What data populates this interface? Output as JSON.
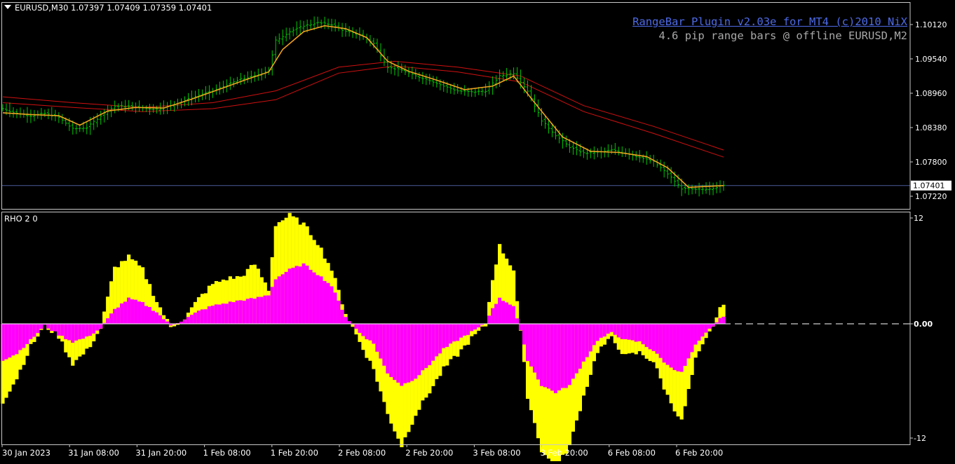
{
  "window": {
    "symbol_line": "EURUSD,M30  1.07397 1.07409 1.07359 1.07401",
    "plugin_title": "RangeBar Plugin v2.03e for MT4 (c)2010 NiX",
    "plugin_subtitle": "4.6 pip range bars @ offline EURUSD,M2",
    "indicator_label": "RHO 2 0"
  },
  "colors": {
    "background": "#000000",
    "bars": "#00c800",
    "ma_fast": "#f0a020",
    "ma_slow": "#d01010",
    "current_price_line": "#4a5a9a",
    "histogram_outer": "#ffff00",
    "histogram_inner": "#ff00ff",
    "axis": "#c8c8c8"
  },
  "chart_data": [
    {
      "type": "candlestick",
      "symbol": "EURUSD",
      "timeframe": "M30",
      "current_price": "1.07401",
      "y_ticks": [
        "1.10120",
        "1.09540",
        "1.08960",
        "1.08380",
        "1.07800",
        "1.07220"
      ],
      "ylim": [
        1.0705,
        1.104
      ],
      "x_ticks": [
        "30 Jan 2023",
        "31 Jan 08:00",
        "31 Jan 20:00",
        "1 Feb 08:00",
        "1 Feb 20:00",
        "2 Feb 08:00",
        "2 Feb 20:00",
        "3 Feb 08:00",
        "3 Feb 20:00",
        "6 Feb 08:00",
        "6 Feb 20:00"
      ],
      "close_path": [
        [
          0,
          1.087
        ],
        [
          4,
          1.0862
        ],
        [
          8,
          1.0858
        ],
        [
          12,
          1.0862
        ],
        [
          16,
          1.0855
        ],
        [
          20,
          1.0836
        ],
        [
          24,
          1.0838
        ],
        [
          28,
          1.0858
        ],
        [
          32,
          1.0874
        ],
        [
          36,
          1.0874
        ],
        [
          40,
          1.0871
        ],
        [
          44,
          1.0869
        ],
        [
          48,
          1.0875
        ],
        [
          52,
          1.0884
        ],
        [
          56,
          1.0893
        ],
        [
          60,
          1.09
        ],
        [
          64,
          1.091
        ],
        [
          68,
          1.092
        ],
        [
          72,
          1.0925
        ],
        [
          76,
          1.0935
        ],
        [
          78,
          1.0985
        ],
        [
          82,
          1.1
        ],
        [
          86,
          1.101
        ],
        [
          90,
          1.1015
        ],
        [
          94,
          1.1012
        ],
        [
          98,
          1.1
        ],
        [
          102,
          1.0995
        ],
        [
          106,
          1.098
        ],
        [
          110,
          1.094
        ],
        [
          114,
          1.0935
        ],
        [
          118,
          1.0925
        ],
        [
          122,
          1.0918
        ],
        [
          126,
          1.0908
        ],
        [
          130,
          1.09
        ],
        [
          134,
          1.0898
        ],
        [
          138,
          1.09
        ],
        [
          142,
          1.0925
        ],
        [
          146,
          1.093
        ],
        [
          150,
          1.09
        ],
        [
          154,
          1.085
        ],
        [
          158,
          1.0825
        ],
        [
          162,
          1.0805
        ],
        [
          166,
          1.0795
        ],
        [
          170,
          1.0796
        ],
        [
          174,
          1.08
        ],
        [
          178,
          1.0795
        ],
        [
          182,
          1.0788
        ],
        [
          186,
          1.078
        ],
        [
          190,
          1.076
        ],
        [
          194,
          1.0735
        ],
        [
          198,
          1.0733
        ],
        [
          202,
          1.0735
        ],
        [
          206,
          1.074
        ]
      ],
      "ma_fast": [
        [
          0,
          1.0863
        ],
        [
          8,
          1.086
        ],
        [
          16,
          1.0858
        ],
        [
          22,
          1.0842
        ],
        [
          30,
          1.0866
        ],
        [
          38,
          1.0872
        ],
        [
          46,
          1.0871
        ],
        [
          54,
          1.0886
        ],
        [
          62,
          1.0903
        ],
        [
          70,
          1.092
        ],
        [
          76,
          1.0932
        ],
        [
          80,
          1.097
        ],
        [
          86,
          1.1
        ],
        [
          92,
          1.101
        ],
        [
          98,
          1.1005
        ],
        [
          104,
          1.099
        ],
        [
          110,
          1.095
        ],
        [
          116,
          1.0933
        ],
        [
          124,
          1.0918
        ],
        [
          132,
          1.0902
        ],
        [
          140,
          1.0908
        ],
        [
          146,
          1.0925
        ],
        [
          152,
          1.088
        ],
        [
          160,
          1.0822
        ],
        [
          168,
          1.0798
        ],
        [
          176,
          1.0796
        ],
        [
          184,
          1.0789
        ],
        [
          190,
          1.077
        ],
        [
          196,
          1.0737
        ],
        [
          206,
          1.074
        ]
      ],
      "ma_slow": [
        [
          0,
          1.089
        ],
        [
          20,
          1.088
        ],
        [
          40,
          1.0872
        ],
        [
          60,
          1.088
        ],
        [
          78,
          1.09
        ],
        [
          96,
          1.094
        ],
        [
          112,
          1.095
        ],
        [
          130,
          1.094
        ],
        [
          148,
          1.0925
        ],
        [
          166,
          1.0875
        ],
        [
          186,
          1.084
        ],
        [
          206,
          1.08
        ]
      ],
      "ma_slow2": [
        [
          0,
          1.088
        ],
        [
          20,
          1.0872
        ],
        [
          40,
          1.0865
        ],
        [
          60,
          1.087
        ],
        [
          78,
          1.0885
        ],
        [
          96,
          1.093
        ],
        [
          112,
          1.0942
        ],
        [
          130,
          1.0932
        ],
        [
          148,
          1.0915
        ],
        [
          166,
          1.0865
        ],
        [
          186,
          1.0828
        ],
        [
          206,
          1.0788
        ]
      ]
    },
    {
      "type": "area",
      "name": "RHO 2 0",
      "y_ticks": [
        "12",
        "0.00",
        "-12"
      ],
      "ylim": [
        -12,
        12
      ],
      "outer": [
        [
          0,
          -8.6
        ],
        [
          4,
          -6.0
        ],
        [
          8,
          -2.5
        ],
        [
          12,
          -0.2
        ],
        [
          16,
          -1.4
        ],
        [
          20,
          -4.4
        ],
        [
          24,
          -3.0
        ],
        [
          28,
          -0.5
        ],
        [
          32,
          6.2
        ],
        [
          36,
          7.4
        ],
        [
          40,
          6.0
        ],
        [
          44,
          2.5
        ],
        [
          48,
          -0.4
        ],
        [
          52,
          0.6
        ],
        [
          56,
          2.8
        ],
        [
          60,
          4.4
        ],
        [
          64,
          5.0
        ],
        [
          68,
          5.2
        ],
        [
          72,
          6.6
        ],
        [
          76,
          3.8
        ],
        [
          78,
          11.0
        ],
        [
          82,
          12.0
        ],
        [
          86,
          11.0
        ],
        [
          90,
          9.0
        ],
        [
          94,
          6.0
        ],
        [
          98,
          1.2
        ],
        [
          102,
          -2.0
        ],
        [
          106,
          -5.0
        ],
        [
          110,
          -10.0
        ],
        [
          114,
          -13.5
        ],
        [
          118,
          -10.0
        ],
        [
          122,
          -7.5
        ],
        [
          126,
          -5.0
        ],
        [
          130,
          -3.4
        ],
        [
          134,
          -1.6
        ],
        [
          138,
          -0.2
        ],
        [
          140,
          5.0
        ],
        [
          142,
          8.6
        ],
        [
          146,
          6.0
        ],
        [
          148,
          -1.0
        ],
        [
          150,
          -8.0
        ],
        [
          154,
          -14.0
        ],
        [
          158,
          -16.0
        ],
        [
          162,
          -13.5
        ],
        [
          166,
          -8.0
        ],
        [
          170,
          -3.0
        ],
        [
          174,
          -1.6
        ],
        [
          178,
          -3.6
        ],
        [
          182,
          -3.2
        ],
        [
          186,
          -4.2
        ],
        [
          190,
          -8.0
        ],
        [
          194,
          -10.8
        ],
        [
          198,
          -4.0
        ],
        [
          202,
          -1.0
        ],
        [
          206,
          2.4
        ]
      ],
      "inner": [
        [
          0,
          -4.0
        ],
        [
          4,
          -3.3
        ],
        [
          8,
          -1.8
        ],
        [
          12,
          -0.2
        ],
        [
          16,
          -1.2
        ],
        [
          20,
          -2.0
        ],
        [
          24,
          -1.5
        ],
        [
          28,
          -0.5
        ],
        [
          32,
          1.6
        ],
        [
          36,
          2.8
        ],
        [
          40,
          2.3
        ],
        [
          44,
          1.3
        ],
        [
          48,
          -0.2
        ],
        [
          52,
          0.5
        ],
        [
          56,
          1.4
        ],
        [
          60,
          2.0
        ],
        [
          64,
          2.3
        ],
        [
          68,
          2.6
        ],
        [
          72,
          2.8
        ],
        [
          76,
          3.2
        ],
        [
          78,
          5.0
        ],
        [
          82,
          6.0
        ],
        [
          86,
          6.6
        ],
        [
          90,
          5.5
        ],
        [
          94,
          4.2
        ],
        [
          98,
          0.8
        ],
        [
          102,
          -1.0
        ],
        [
          106,
          -2.2
        ],
        [
          110,
          -5.5
        ],
        [
          114,
          -6.8
        ],
        [
          118,
          -6.0
        ],
        [
          122,
          -4.5
        ],
        [
          126,
          -2.8
        ],
        [
          130,
          -1.8
        ],
        [
          134,
          -0.9
        ],
        [
          138,
          0.0
        ],
        [
          140,
          1.8
        ],
        [
          142,
          2.8
        ],
        [
          146,
          2.0
        ],
        [
          148,
          -0.8
        ],
        [
          150,
          -4.0
        ],
        [
          154,
          -6.8
        ],
        [
          158,
          -7.6
        ],
        [
          162,
          -6.8
        ],
        [
          166,
          -4.2
        ],
        [
          170,
          -1.8
        ],
        [
          174,
          -1.0
        ],
        [
          178,
          -1.8
        ],
        [
          182,
          -2.0
        ],
        [
          186,
          -3.0
        ],
        [
          190,
          -4.6
        ],
        [
          194,
          -5.4
        ],
        [
          198,
          -2.4
        ],
        [
          202,
          -0.6
        ],
        [
          206,
          0.9
        ]
      ]
    }
  ]
}
